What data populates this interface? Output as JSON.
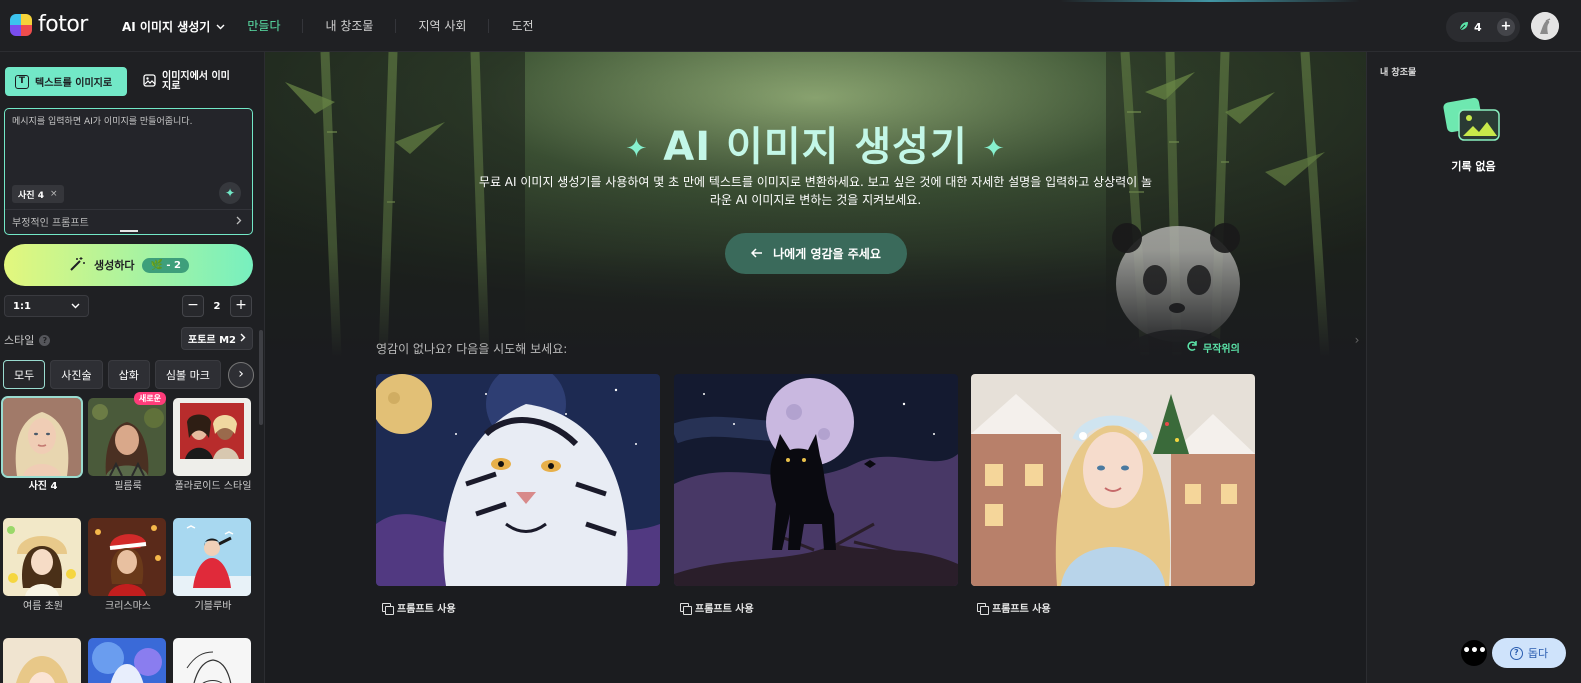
{
  "header": {
    "logo_text": "fotor",
    "tool_dropdown": "AI 이미지 생성기",
    "nav": [
      "만들다",
      "내 창조물",
      "지역 사회",
      "도전"
    ],
    "credits": "4",
    "add_credits": "+"
  },
  "sidebar": {
    "tabs": [
      {
        "label": "텍스트를 이미지로",
        "icon": "text-icon"
      },
      {
        "label": "이미지에서 이미지로",
        "icon": "image-icon"
      }
    ],
    "prompt_text": "메시지를 입력하면 AI가 이미지를 만들어줍니다.",
    "photo_chip": "사진 4",
    "chip_close": "×",
    "negative_prompt": "부정적인 프롬프트",
    "generate_label": "생성하다",
    "generate_cost": "- 2",
    "ratio": "1:1",
    "count": "2",
    "style_label": "스타일",
    "model_label": "포토르 M2",
    "categories": [
      "모두",
      "사진술",
      "삽화",
      "심볼 마크"
    ],
    "styles": [
      {
        "name": "사진 4",
        "selected": true
      },
      {
        "name": "필름룩",
        "badge": "새로운"
      },
      {
        "name": "폴라로이드 스타일"
      },
      {
        "name": "여름 초원"
      },
      {
        "name": "크리스마스"
      },
      {
        "name": "기블루바"
      }
    ]
  },
  "hero": {
    "title": "AI 이미지 생성기",
    "subtitle": "무료 AI 이미지 생성기를 사용하여 몇 초 만에 텍스트를 이미지로 변환하세요. 보고 싶은 것에 대한 자세한 설명을 입력하고 상상력이 놀라운 AI 이미지로 변하는 것을 지켜보세요.",
    "inspire_button": "나에게 영감을 주세요"
  },
  "ideas": {
    "label": "영감이 없나요? 다음을 시도해 보세요:",
    "random_label": "무작위의",
    "cards": [
      {
        "subject": "white tiger under moon",
        "action": "프롬프트 사용"
      },
      {
        "subject": "black cat and full moon",
        "action": "프롬프트 사용"
      },
      {
        "subject": "winter princess with gingerbread houses",
        "action": "프롬프트 사용"
      }
    ]
  },
  "right_panel": {
    "title": "내 창조물",
    "empty_text": "기록 없음"
  },
  "floating": {
    "more": "•••",
    "help": "돕다"
  },
  "colors": {
    "accent": "#72e8c7",
    "nav_active": "#5be3a8",
    "background": "#1b1c1f",
    "panel": "#1f2023",
    "new_badge": "#ff3c7a"
  }
}
